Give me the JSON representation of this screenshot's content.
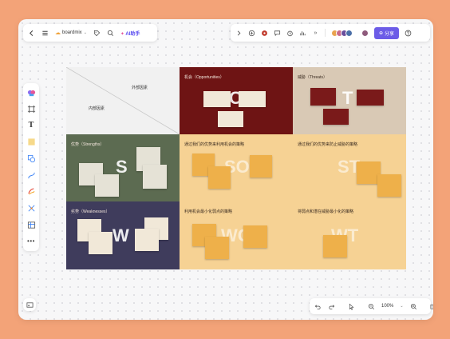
{
  "toolbar": {
    "brand": "boardmix",
    "ai_label": "AI助手",
    "share_label": "分享"
  },
  "zoom": {
    "value": "100%"
  },
  "swot": {
    "header": {
      "external": "外部因素",
      "internal": "内部因素"
    },
    "opportunities": {
      "title": "机会（Opportunities）",
      "letter": "O"
    },
    "threats": {
      "title": "威胁（Threats）",
      "letter": "T"
    },
    "strengths": {
      "title": "优势（Strengths）",
      "letter": "S"
    },
    "weaknesses": {
      "title": "劣势（Weaknesses）",
      "letter": "W"
    },
    "so": {
      "title": "通过我们的优势来利用机会的策略",
      "letter": "SO"
    },
    "st": {
      "title": "通过我们的优势来防止威胁的策略",
      "letter": "ST"
    },
    "wo": {
      "title": "利用机会最小化弱点的策略",
      "letter": "WO"
    },
    "wt": {
      "title": "将弱点和潜在威胁最小化的策略",
      "letter": "WT"
    }
  },
  "colors": {
    "accent": "#6c5ce7",
    "opportunities": "#6e1414",
    "threats": "#d9c9b5",
    "strengths": "#5c6b51",
    "weaknesses": "#3f3c5c",
    "strategy": "#f6d294",
    "sticky": "#eeb04a"
  }
}
